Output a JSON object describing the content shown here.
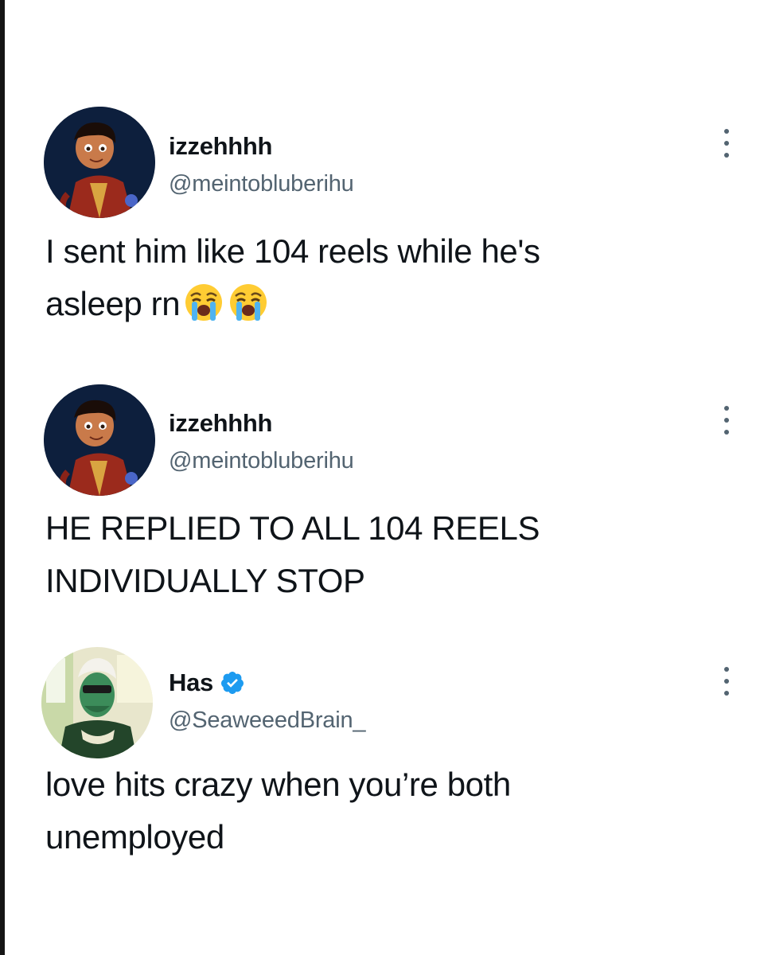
{
  "tweets": [
    {
      "display_name": "izzehhhh",
      "handle": "@meintobluberihu",
      "text": "I sent him like 104 reels while he's\nasleep rn",
      "emoji": [
        "loudly-crying-face-icon",
        "loudly-crying-face-icon"
      ],
      "verified": false
    },
    {
      "display_name": "izzehhhh",
      "handle": "@meintobluberihu",
      "text": "HE REPLIED TO ALL 104 REELS\nINDIVIDUALLY STOP",
      "verified": false
    },
    {
      "display_name": "Has",
      "handle": "@SeaweeedBrain_",
      "text": "love hits crazy when you’re both\nunemployed",
      "verified": true
    }
  ],
  "colors": {
    "text": "#0f1419",
    "handle": "#536471",
    "verified": "#1d9bf0",
    "background": "#ffffff"
  }
}
